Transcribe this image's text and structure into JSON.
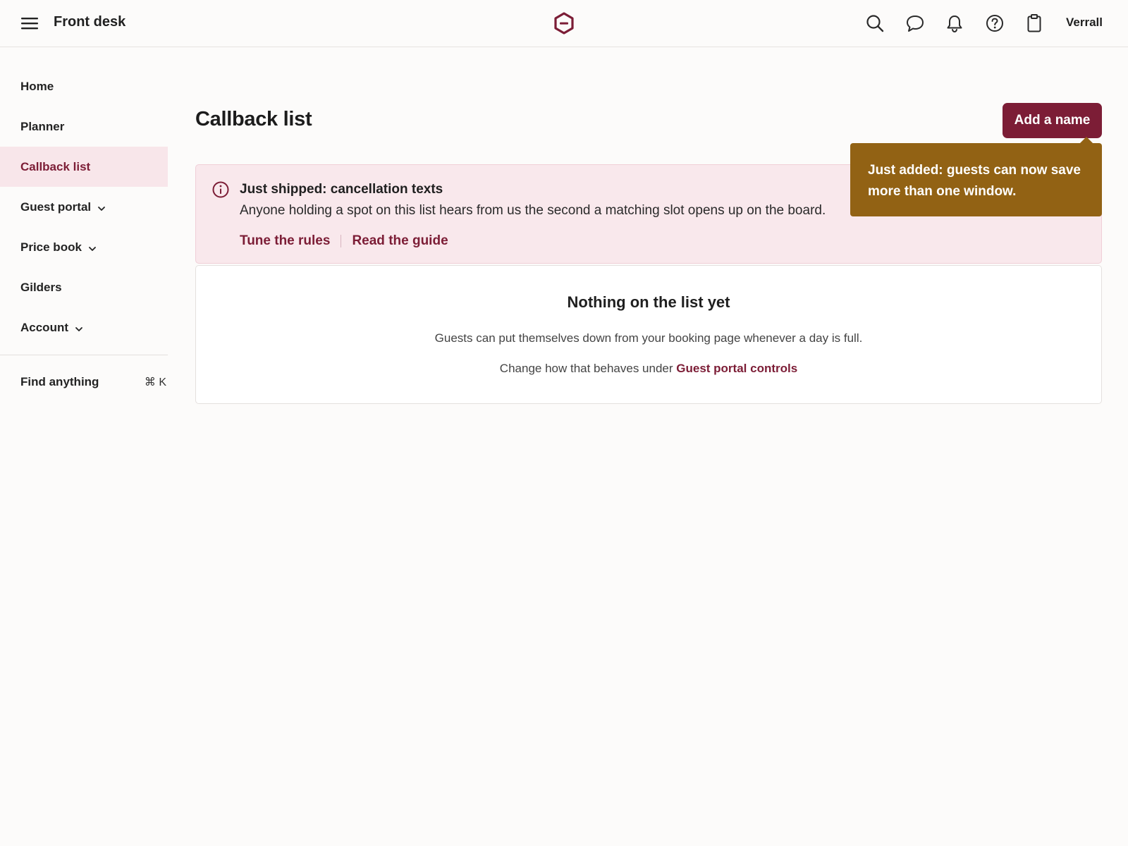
{
  "header": {
    "app_title": "Front desk",
    "user_name": "Verrall",
    "icons": [
      "menu-icon",
      "logo-icon",
      "search-icon",
      "chat-icon",
      "bell-icon",
      "help-icon",
      "clipboard-icon"
    ]
  },
  "sidebar": {
    "items": [
      {
        "label": "Home",
        "active": false,
        "expandable": false
      },
      {
        "label": "Planner",
        "active": false,
        "expandable": false
      },
      {
        "label": "Callback list",
        "active": true,
        "expandable": false
      },
      {
        "label": "Guest portal",
        "active": false,
        "expandable": true
      },
      {
        "label": "Price book",
        "active": false,
        "expandable": true
      },
      {
        "label": "Gilders",
        "active": false,
        "expandable": false
      },
      {
        "label": "Account",
        "active": false,
        "expandable": true
      }
    ],
    "find": {
      "label": "Find anything",
      "shortcut": "⌘ K"
    }
  },
  "main": {
    "title": "Callback list",
    "primary_button": "Add a name",
    "tooltip": "Just added: guests can now save more than one window.",
    "banner": {
      "title": "Just shipped: cancellation texts",
      "body": "Anyone holding a spot on this list hears from us the second a matching slot opens up on the board.",
      "links": [
        "Tune the rules",
        "Read the guide"
      ]
    },
    "empty_state": {
      "title": "Nothing on the list yet",
      "body": "Guests can put themselves down from your booking page whenever a day is full.",
      "hint_prefix": "Change how that behaves under ",
      "hint_link": "Guest portal controls"
    }
  },
  "colors": {
    "accent": "#7c1d36",
    "active_bg": "#f8e6ea",
    "banner_bg": "#f9e8ec",
    "tooltip_bg": "#926214",
    "page_bg": "#fcfbfa"
  }
}
